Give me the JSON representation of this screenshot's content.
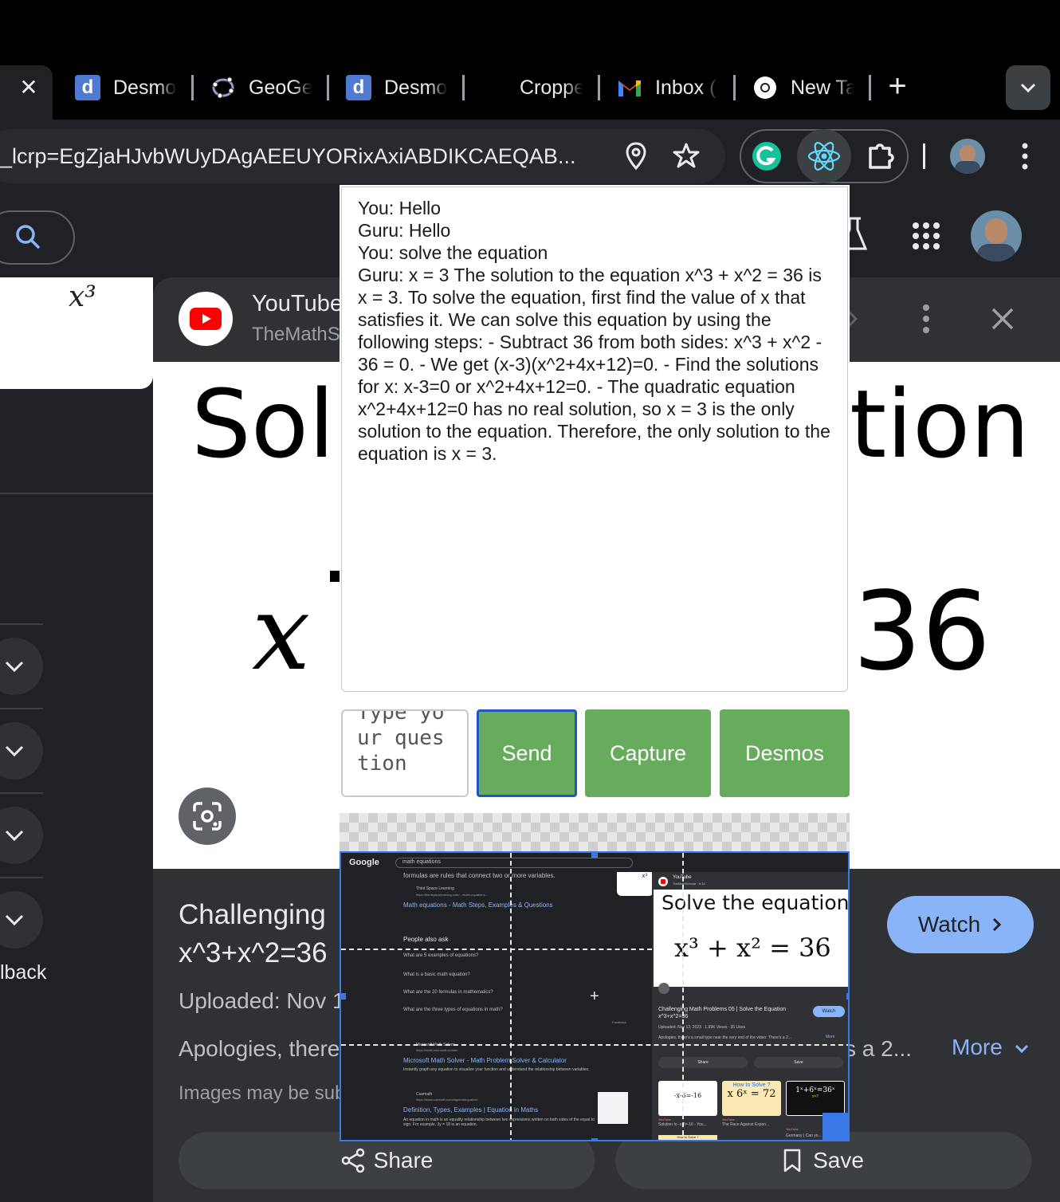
{
  "browser": {
    "tabs": [
      {
        "label": "Desmo",
        "icon": "desmos-icon",
        "color": "#3b6ec9"
      },
      {
        "label": "GeoGe",
        "icon": "geogebra-icon",
        "color": "#666699"
      },
      {
        "label": "Desmo",
        "icon": "desmos-icon",
        "color": "#3b6ec9"
      },
      {
        "label": "Croppe",
        "icon": "blank-icon",
        "color": ""
      },
      {
        "label": "Inbox (",
        "icon": "gmail-icon",
        "color": "#ea4335"
      },
      {
        "label": "New Ta",
        "icon": "chrome-icon",
        "color": "#ffffff"
      }
    ],
    "url": "_lcrp=EgZjaHJvbWUyDAgAEEUYORixAxiABDIKCAEQAB..."
  },
  "youtube": {
    "title": "YouTube",
    "channel": "TheMathS",
    "video_line1": "Solve the equation",
    "video_left": "Sol",
    "video_right": "tion",
    "video_x": "x",
    "video_36": "36",
    "desc_title_1": "Challenging",
    "desc_title_2": "x^3+x^2=36",
    "uploaded": "Uploaded: Nov 1",
    "apologies": "Apologies, there",
    "apologies_tail": "s a 2...",
    "images_note": "Images may be sub",
    "watch": "Watch",
    "more": "More",
    "share": "Share",
    "save": "Save",
    "left_card_text": "x³",
    "left_feedback": "lback"
  },
  "chat": {
    "lines": [
      "You: Hello",
      "Guru: Hello",
      "You: solve the equation",
      "Guru: x = 3 The solution to the equation x^3 + x^2 = 36 is x = 3. To solve the equation, first find the value of x that satisfies it. We can solve this equation by using the following steps: - Subtract 36 from both sides: x^3 + x^2 - 36 = 0. - We get (x-3)(x^2+4x+12)=0. - Find the solutions for x: x-3=0 or x^2+4x+12=0. - The quadratic equation x^2+4x+12=0 has no real solution, so x = 3 is the only solution to the equation. Therefore, the only solution to the equation is x = 3."
    ],
    "input_placeholder": "Type your question",
    "send": "Send",
    "capture": "Capture",
    "desmos": "Desmos"
  },
  "capture": {
    "search_query": "math equations",
    "formula_text": "formulas are rules that connect two or more variables.",
    "r1_site": "Third Space Learning",
    "r1_url": "https://thirdspacelearning.com/.../math-equations...",
    "r1_title": "Math equations - Math Steps, Examples & Questions",
    "paa": "People also ask",
    "q1": "What are 5 examples of equations?",
    "q2": "What is a basic math equation?",
    "q3": "What are the 20 formulas in mathematics?",
    "q4": "What are the three types of equations in math?",
    "feedback": "Feedback",
    "r2_site": "Microsoft Math Solver",
    "r2_url": "https://math.microsoft.com/en",
    "r2_title": "Microsoft Math Solver - Math Problem Solver & Calculator",
    "r2_desc": "Instantly graph any equation to visualize your function and understand the relationship between variables.",
    "r3_site": "Cuemath",
    "r3_url": "https://www.cuemath.com/algebra/equation/",
    "r3_title": "Definition, Types, Examples | Equation in Maths",
    "r3_desc": "An equation in math is an equality relationship between two expressions written on both sides of the equal to sign. For example, 3y = 18 is an equation.",
    "yt_title": "YouTube",
    "yt_channel": "TheMathScholar · 6:34",
    "video_title": "Solve the equation",
    "video_eq": "x³ + x² = 36",
    "desc": "Challenging Math Problems 05 | Solve the Equation x^3+x^2=36",
    "stats": "Uploaded: Nov 13, 2023 · 1.99K Views · 35 Likes",
    "apol": "Apologies, there's a small typo near the very end of the video: There's a 2...",
    "more": "More",
    "watch": "Watch",
    "share": "Share",
    "save": "Save",
    "t1": "-x-6=-16",
    "t2_head": "How to Solve ?",
    "t2_eq": "x 6ˣ = 72",
    "t3_eq": "1ˣ+6ˣ=36ˣ",
    "t3_sub": "x=?",
    "c1": "Solution to -x-6=-16 - You...",
    "c2": "The Race Against Expon...",
    "c3": "Germany | Can yo...",
    "src": "YouTube",
    "how": "How to Solve ?",
    "left_x3": "x³"
  }
}
